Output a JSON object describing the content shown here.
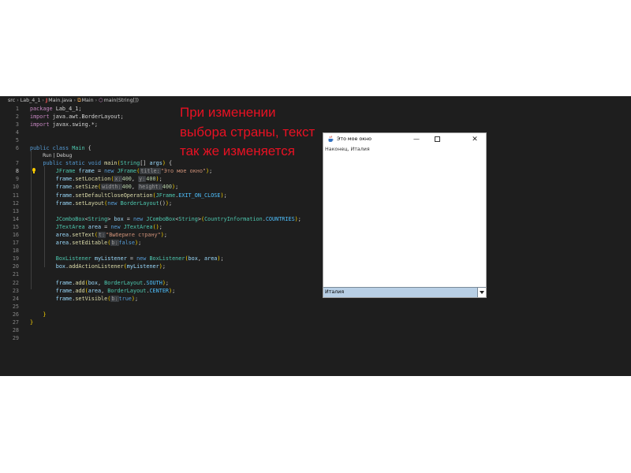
{
  "breadcrumb": {
    "src": "src",
    "package": "Lab_4_1",
    "file_icon": "J",
    "file": "Main.java",
    "class_icon": "class-icon",
    "class": "Main",
    "method_icon": "method-icon",
    "method": "main(String[])"
  },
  "editor": {
    "active_line": 8,
    "lens_text": [
      "Run",
      "Debug"
    ],
    "line_numbers": [
      "1",
      "2",
      "3",
      "4",
      "5",
      "6",
      "7",
      "8",
      "9",
      "10",
      "11",
      "12",
      "13",
      "14",
      "15",
      "16",
      "17",
      "18",
      "19",
      "20",
      "21",
      "22",
      "23",
      "24",
      "25",
      "26",
      "27",
      "28",
      "29"
    ],
    "code": {
      "l1_kw": "package",
      "l1_rest": " Lab_4_1;",
      "l2_kw": "import",
      "l2_rest": " java.awt.BorderLayout;",
      "l3_kw": "import",
      "l3_rest": " javax.swing.*;",
      "l6_kw1": "public",
      "l6_kw2": "class",
      "l6_name": "Main",
      "l6_rest": " {",
      "l7_kw1": "public",
      "l7_kw2": "static",
      "l7_kw3": "void",
      "l7_method": "main",
      "l7_type": "String",
      "l7_param": "args",
      "l8_type1": "JFrame",
      "l8_var": "frame",
      "l8_new": "new",
      "l8_type2": "JFrame",
      "l8_hint": "title:",
      "l8_str": "\"Это мое окно\"",
      "l9_obj": "frame",
      "l9_method": "setLocation",
      "l9_hint1": "x:",
      "l9_n1": "400",
      "l9_hint2": "y:",
      "l9_n2": "400",
      "l10_obj": "frame",
      "l10_method": "setSize",
      "l10_hint1": "width:",
      "l10_n1": "400",
      "l10_hint2": "height:",
      "l10_n2": "400",
      "l11_obj": "frame",
      "l11_method": "setDefaultCloseOperation",
      "l11_type": "JFrame",
      "l11_const": "EXIT_ON_CLOSE",
      "l12_obj": "frame",
      "l12_method": "setLayout",
      "l12_new": "new",
      "l12_type": "BorderLayout",
      "l14_type1": "JComboBox",
      "l14_type2": "String",
      "l14_var": "box",
      "l14_new": "new",
      "l14_type3": "JComboBox",
      "l14_type4": "String",
      "l14_type5": "CountryInformation",
      "l14_const": "COUNTRIES",
      "l15_type1": "JTextArea",
      "l15_var": "area",
      "l15_new": "new",
      "l15_type2": "JTextArea",
      "l16_obj": "area",
      "l16_method": "setText",
      "l16_hint": "t:",
      "l16_str": "\"Выберите страну\"",
      "l17_obj": "area",
      "l17_method": "setEditable",
      "l17_hint": "b:",
      "l17_kw": "false",
      "l19_type1": "BoxListener",
      "l19_var": "myListener",
      "l19_new": "new",
      "l19_type2": "BoxListener",
      "l19_arg1": "box",
      "l19_arg2": "area",
      "l20_obj": "box",
      "l20_method": "addActionListener",
      "l20_arg": "myListener",
      "l22_obj": "frame",
      "l22_method": "add",
      "l22_arg": "box",
      "l22_type": "BorderLayout",
      "l22_const": "SOUTH",
      "l23_obj": "frame",
      "l23_method": "add",
      "l23_arg": "area",
      "l23_type": "BorderLayout",
      "l23_const": "CENTER",
      "l24_obj": "frame",
      "l24_method": "setVisible",
      "l24_hint": "b:",
      "l24_kw": "true",
      "l26": "}",
      "l27": "}"
    }
  },
  "annotation": {
    "line1": "При изменении",
    "line2": "выбора страны, текст",
    "line3": "так же изменяется"
  },
  "app_window": {
    "title": "Это мое окно",
    "minimize": "—",
    "close": "✕",
    "text_content": "Наконец, Италия",
    "combo_value": "Италия",
    "combo_bg": "#b8cfe5"
  }
}
